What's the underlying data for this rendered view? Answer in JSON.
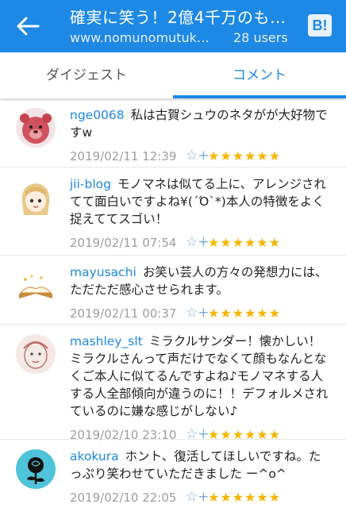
{
  "header": {
    "title": "確実に笑う！2億4千万のも…",
    "url": "www.nomunomutuk…",
    "users": "28 users",
    "bookmark_label": "B!"
  },
  "tabs": [
    {
      "label": "ダイジェスト"
    },
    {
      "label": "コメント"
    }
  ],
  "comments": [
    {
      "user": "nge0068",
      "text": "私は古賀シュウのネタがが大好物ですw",
      "date": "2019/02/11 12:39",
      "stars": "★★★★★★"
    },
    {
      "user": "jii-blog",
      "text": "モノマネは似てる上に、アレンジされてて面白いですよね¥(´Ό`*)本人の特徴をよく捉えててスゴい！",
      "date": "2019/02/11 07:54",
      "stars": "★★★★★★"
    },
    {
      "user": "mayusachi",
      "text": "お笑い芸人の方々の発想力には、ただただ感心させられます。",
      "date": "2019/02/11 00:37",
      "stars": "★★★★★★"
    },
    {
      "user": "mashley_slt",
      "text": "ミラクルサンダー！懐かしい！ミラクルさんって声だけでなくて顔もなんとなくご本人に似てるんですよね♪モノマネする人する人全部傾向が違うのに！！デフォルメされているのに嫌な感じがしない♪",
      "date": "2019/02/10 23:10",
      "stars": "★★★★★★"
    },
    {
      "user": "akokura",
      "text": "ホント、復活してほしいですね。たっぷり笑わせていただきました ー^o^",
      "date": "2019/02/10 22:05",
      "stars": "★★★★★★"
    }
  ],
  "star_add_icon": "☆+",
  "colors": {
    "accent": "#1e88e5",
    "star": "#f7b500",
    "date": "#9e9e9e"
  }
}
